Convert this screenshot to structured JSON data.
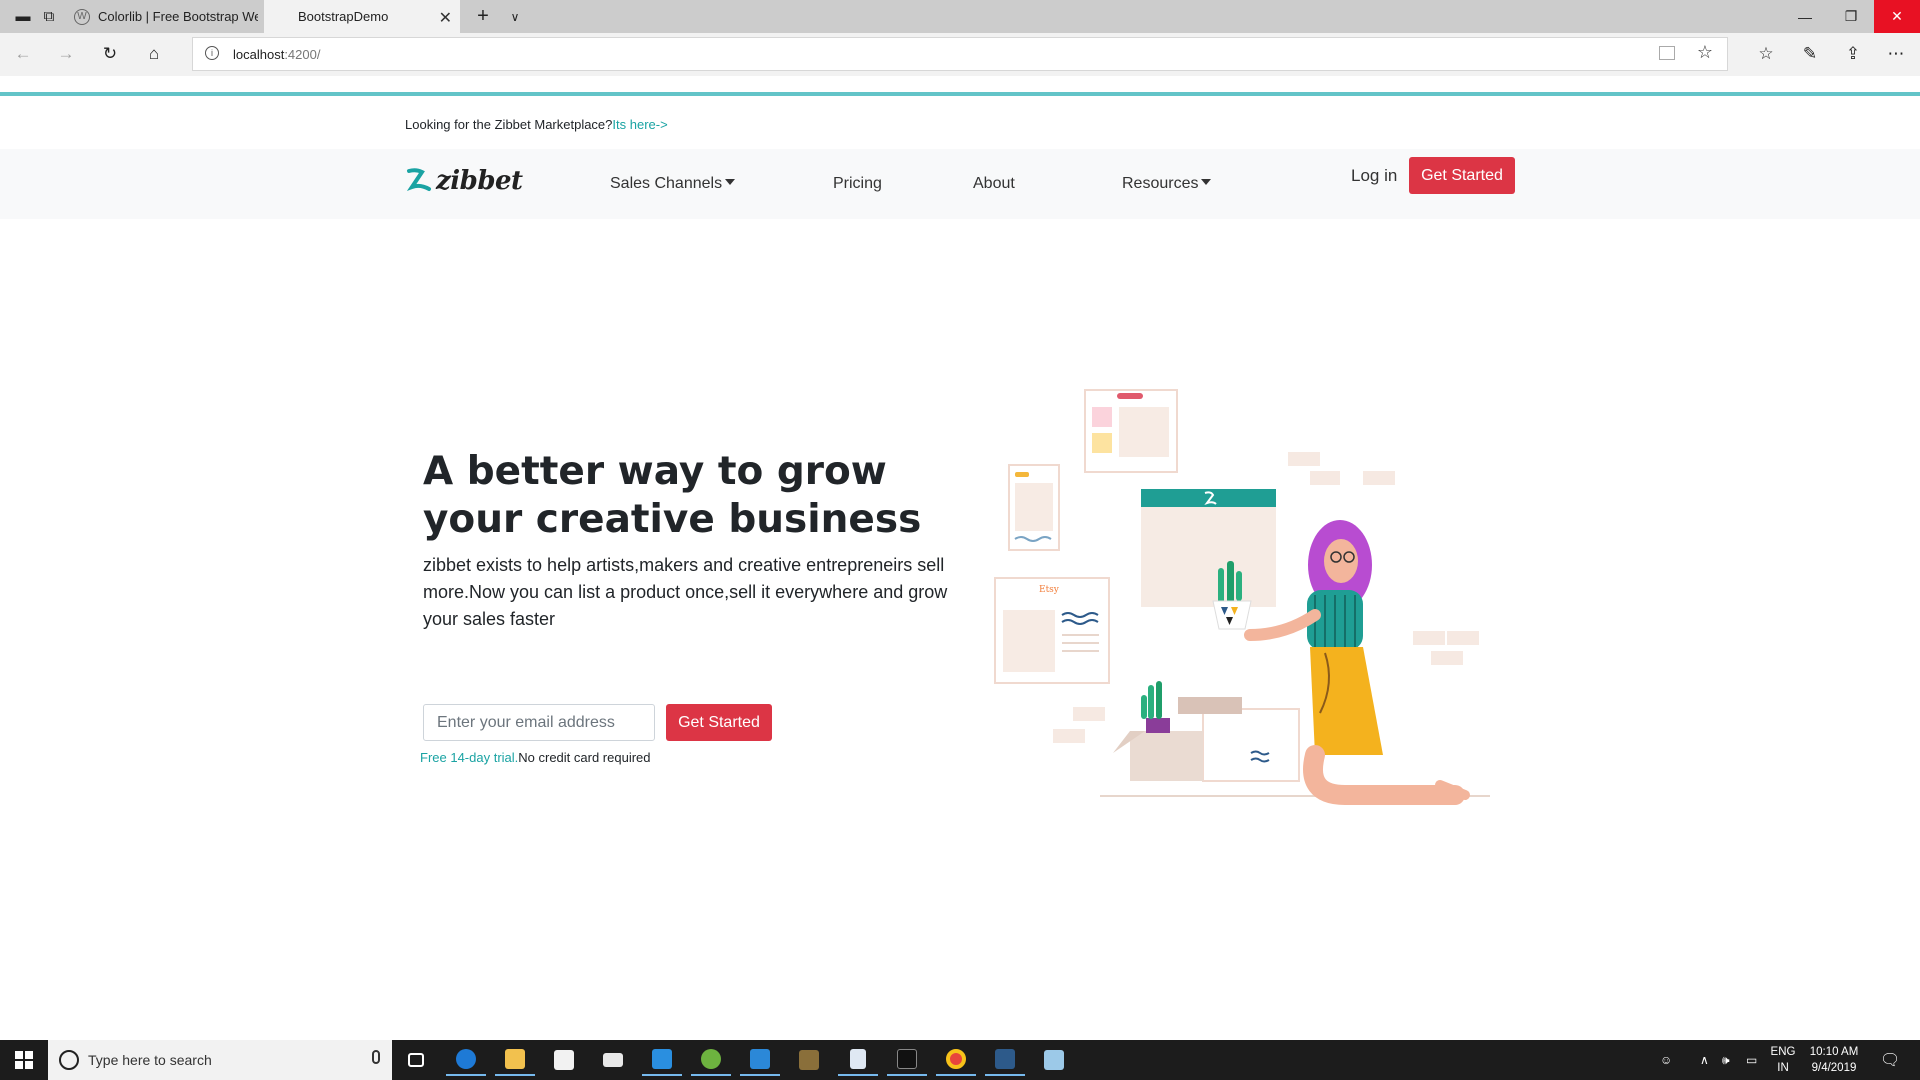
{
  "browser": {
    "tabs": [
      {
        "title": "Colorlib | Free Bootstrap We",
        "active": false
      },
      {
        "title": "BootstrapDemo",
        "active": true
      }
    ],
    "url_host": "localhost",
    "url_rest": ":4200/"
  },
  "announcement": {
    "text": "Looking for the Zibbet Marketplace?",
    "link": "Its here->"
  },
  "site_nav": {
    "logo_text": "zibbet",
    "links": [
      "Sales Channels",
      "Pricing",
      "About",
      "Resources"
    ],
    "login": "Log in",
    "cta": "Get Started"
  },
  "hero": {
    "title": "A better way to grow your creative business",
    "subtitle": "zibbet exists to help artists,makers and creative entrepreneirs sell more.Now you can list a product once,sell it everywhere and grow your sales faster",
    "email_placeholder": "Enter your email address",
    "cta": "Get Started",
    "trial_link": "Free 14-day trial.",
    "trial_note": "No credit card required",
    "illustration_card_label": "Etsy"
  },
  "taskbar": {
    "search_placeholder": "Type here to search",
    "lang_line1": "ENG",
    "lang_line2": "IN",
    "time": "10:10 AM",
    "date": "9/4/2019",
    "apps": [
      "task-view",
      "edge",
      "file-explorer",
      "store",
      "mail",
      "vscode",
      "spring-tool-suite",
      "upload-app",
      "media-app",
      "notepad",
      "terminal",
      "chrome",
      "sql-tool",
      "notes-app"
    ]
  },
  "colors": {
    "accent_red": "#dc3545",
    "teal": "#1aa3a3",
    "teal_line": "#63c4c8"
  }
}
